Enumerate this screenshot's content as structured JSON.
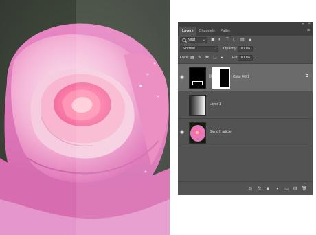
{
  "panel": {
    "collapse_icon": "«",
    "close_icon": "×",
    "tabs": [
      {
        "label": "Layers",
        "active": true
      },
      {
        "label": "Channels",
        "active": false
      },
      {
        "label": "Paths",
        "active": false
      }
    ],
    "menu_icon": "≡",
    "filter": {
      "label": "Kind",
      "icon": "search-icon"
    },
    "blend_mode": "Normal",
    "opacity_label": "Opacity:",
    "opacity_value": "100%",
    "lock_label": "Lock:",
    "fill_label": "Fill:",
    "fill_value": "100%"
  },
  "layers": [
    {
      "name": "Color Fill 1",
      "visible": true,
      "selected": true
    },
    {
      "name": "Layer 1",
      "visible": false,
      "selected": false
    },
    {
      "name": "Blend If article",
      "visible": true,
      "selected": false
    }
  ],
  "bottom_icons": [
    "link-icon",
    "fx-icon",
    "mask-icon",
    "adjustment-icon",
    "folder-icon",
    "new-layer-icon",
    "trash-icon"
  ],
  "colors": {
    "panel_bg": "#535353",
    "panel_header": "#3f3f3f",
    "selected_row": "#6b6b6b",
    "rose_pink": "#e877b8",
    "rose_core": "#ff7aa8",
    "leaf_dark": "#0b1208"
  }
}
